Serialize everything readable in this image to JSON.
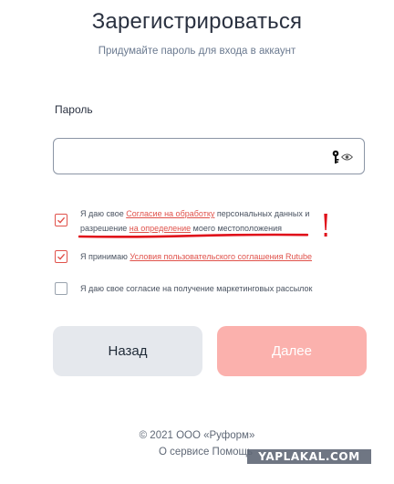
{
  "header": {
    "title": "Зарегистрироваться",
    "subtitle": "Придумайте пароль для входа в аккаунт"
  },
  "password": {
    "label": "Пароль",
    "value": "",
    "key_icon": "key-icon",
    "eye_icon": "eye-icon"
  },
  "consents": [
    {
      "checked": true,
      "text_1": "Я даю свое ",
      "link_1": "Согласие на обработку",
      "text_2": " персональных данных и разрешение ",
      "link_2": "на определение",
      "text_3": " моего местоположения"
    },
    {
      "checked": true,
      "text_1": "Я принимаю ",
      "link_1": "Условия пользовательского соглашения Rutube"
    },
    {
      "checked": false,
      "text_1": "Я даю свое согласие на получение маркетинговых рассылок"
    }
  ],
  "annotation": {
    "mark": "!",
    "color": "#e0101a"
  },
  "buttons": {
    "back_label": "Назад",
    "next_label": "Далее"
  },
  "footer": {
    "copyright": "© 2021 ООО «Руформ»",
    "about": "О сервисе Помощь"
  },
  "watermark": "YAPLAKAL.COM",
  "colors": {
    "accent": "#e0524b",
    "next_button": "#fbb1ad",
    "back_button": "#e5e8ed"
  }
}
